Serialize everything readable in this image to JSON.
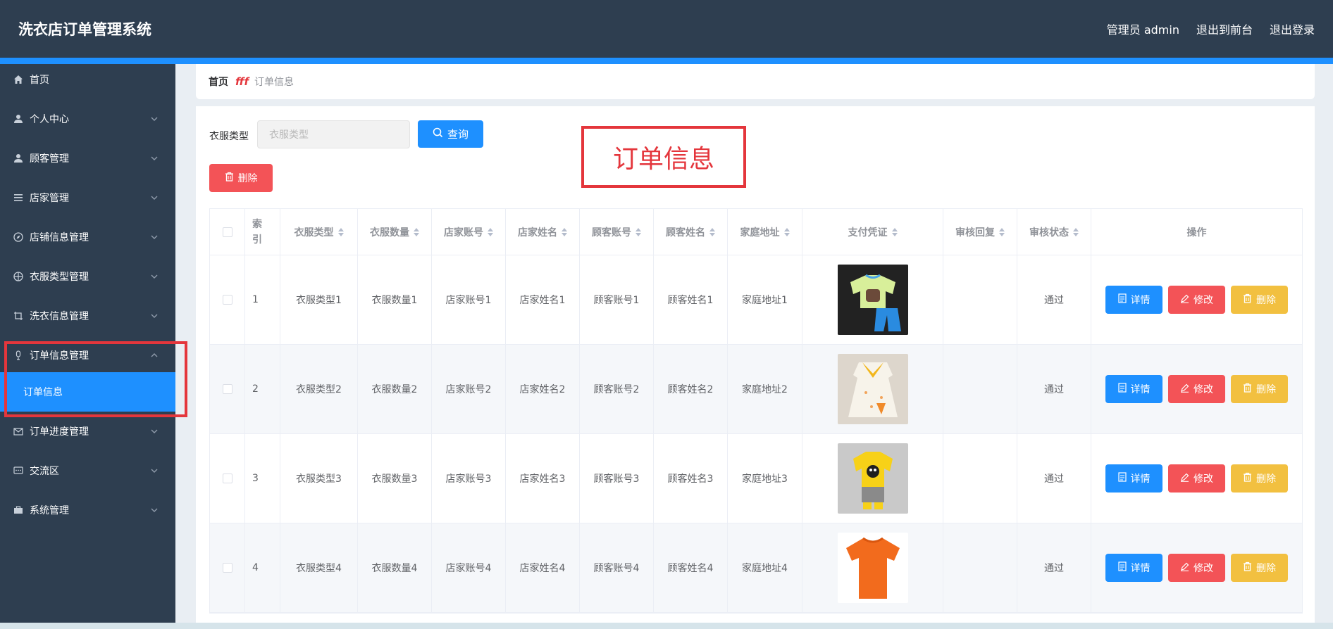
{
  "header": {
    "title": "洗衣店订单管理系统",
    "admin_label": "管理员 admin",
    "front_link": "退出到前台",
    "logout_link": "退出登录"
  },
  "sidebar": {
    "items": [
      {
        "label": "首页",
        "icon": "home-icon"
      },
      {
        "label": "个人中心",
        "icon": "user-icon"
      },
      {
        "label": "顾客管理",
        "icon": "user-icon"
      },
      {
        "label": "店家管理",
        "icon": "list-icon"
      },
      {
        "label": "店铺信息管理",
        "icon": "compass-icon"
      },
      {
        "label": "衣服类型管理",
        "icon": "crosshair-icon"
      },
      {
        "label": "洗衣信息管理",
        "icon": "crop-icon"
      },
      {
        "label": "订单信息管理",
        "icon": "microphone-icon"
      },
      {
        "label": "订单进度管理",
        "icon": "mail-icon"
      },
      {
        "label": "交流区",
        "icon": "chat-icon"
      },
      {
        "label": "系统管理",
        "icon": "briefcase-icon"
      }
    ],
    "active_sub": "订单信息"
  },
  "breadcrumb": {
    "home": "首页",
    "separator": "fff",
    "current": "订单信息"
  },
  "search": {
    "label": "衣服类型",
    "placeholder": "衣服类型",
    "query_button": "查询"
  },
  "toolbar": {
    "delete_button": "删除"
  },
  "page_title": "订单信息",
  "table": {
    "headers": {
      "index": "索引",
      "type": "衣服类型",
      "qty": "衣服数量",
      "shop_account": "店家账号",
      "shop_name": "店家姓名",
      "customer_account": "顾客账号",
      "customer_name": "顾客姓名",
      "address": "家庭地址",
      "payment": "支付凭证",
      "reply": "审核回复",
      "status": "审核状态",
      "ops": "操作"
    },
    "rows": [
      {
        "index": "1",
        "type": "衣服类型1",
        "qty": "衣服数量1",
        "shop_account": "店家账号1",
        "shop_name": "店家姓名1",
        "customer_account": "顾客账号1",
        "customer_name": "顾客姓名1",
        "address": "家庭地址1",
        "reply": "",
        "status": "通过"
      },
      {
        "index": "2",
        "type": "衣服类型2",
        "qty": "衣服数量2",
        "shop_account": "店家账号2",
        "shop_name": "店家姓名2",
        "customer_account": "顾客账号2",
        "customer_name": "顾客姓名2",
        "address": "家庭地址2",
        "reply": "",
        "status": "通过"
      },
      {
        "index": "3",
        "type": "衣服类型3",
        "qty": "衣服数量3",
        "shop_account": "店家账号3",
        "shop_name": "店家姓名3",
        "customer_account": "顾客账号3",
        "customer_name": "顾客姓名3",
        "address": "家庭地址3",
        "reply": "",
        "status": "通过"
      },
      {
        "index": "4",
        "type": "衣服类型4",
        "qty": "衣服数量4",
        "shop_account": "店家账号4",
        "shop_name": "店家姓名4",
        "customer_account": "顾客账号4",
        "customer_name": "顾客姓名4",
        "address": "家庭地址4",
        "reply": "",
        "status": "通过"
      }
    ],
    "ops": {
      "detail": "详情",
      "edit": "修改",
      "delete": "删除"
    }
  },
  "colors": {
    "header_bg": "#2e3e50",
    "accent": "#1e90ff",
    "danger": "#f35357",
    "warning": "#f2c040",
    "highlight": "#e4363c"
  }
}
